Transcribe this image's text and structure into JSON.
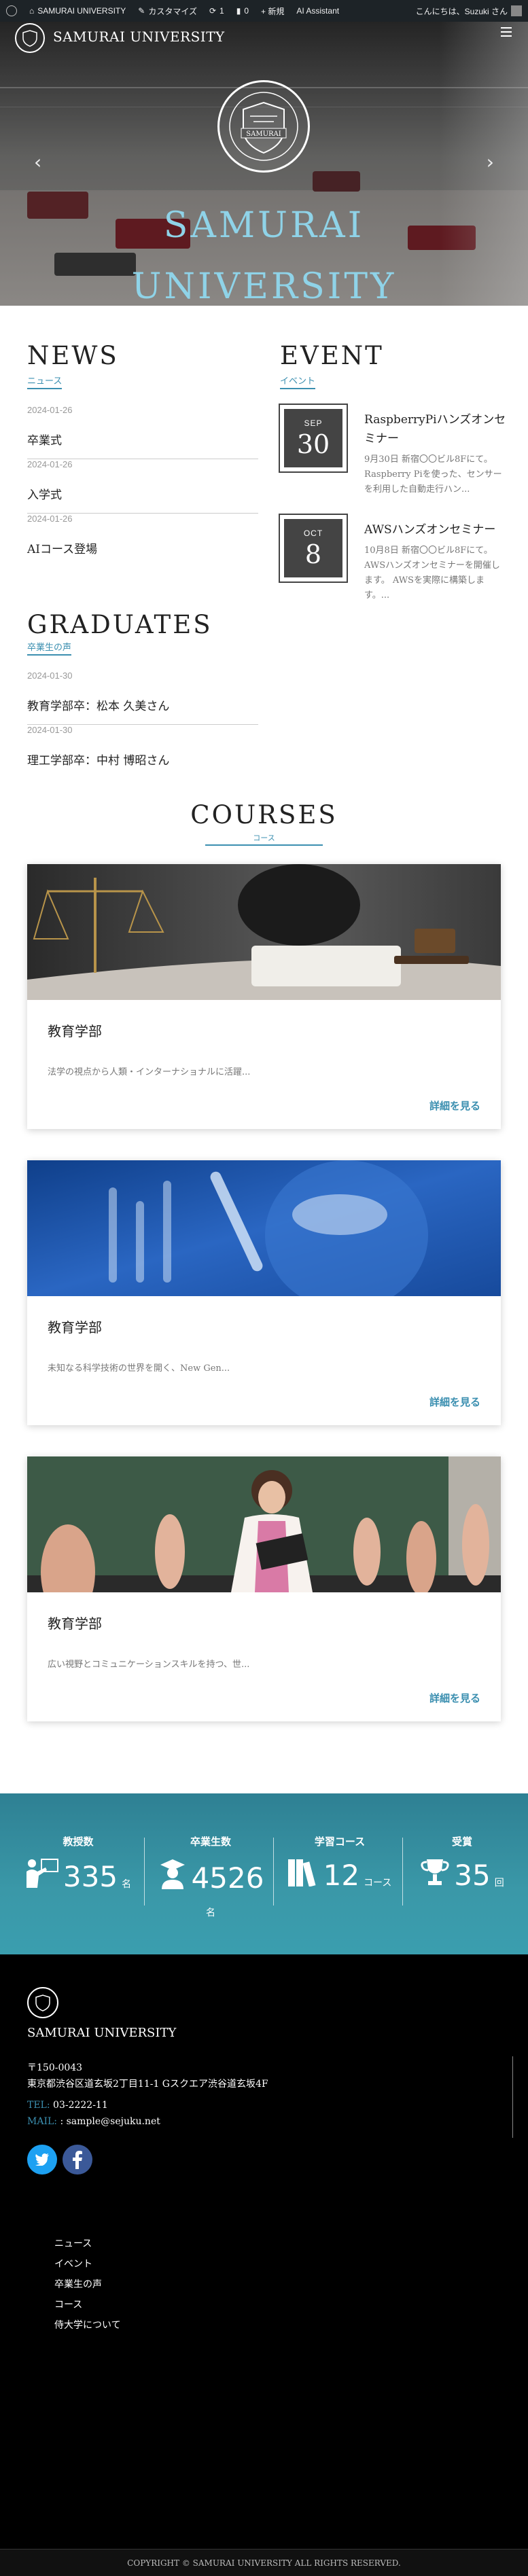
{
  "admin_bar": {
    "site_name": "SAMURAI UNIVERSITY",
    "customize": "カスタマイズ",
    "updates_count": "1",
    "comments_count": "0",
    "new": "+ 新規",
    "ai_assistant": "AI Assistant",
    "greeting": "こんにちは、Suzuki さん"
  },
  "header": {
    "site_name": "SAMURAI UNIVERSITY",
    "crest_text": "SAMURAI",
    "hero_title_line1": "SAMURAI",
    "hero_title_line2": "UNIVERSITY"
  },
  "news": {
    "heading": "NEWS",
    "subheading": "ニュース",
    "items": [
      {
        "date": "2024-01-26",
        "title": "卒業式"
      },
      {
        "date": "2024-01-26",
        "title": "入学式"
      },
      {
        "date": "2024-01-26",
        "title": "AIコース登場"
      }
    ]
  },
  "event": {
    "heading": "EVENT",
    "subheading": "イベント",
    "items": [
      {
        "month": "SEP",
        "day": "30",
        "title": "RaspberryPiハンズオンセミナー",
        "text": "9月30日 新宿〇〇ビル8Fにて。Raspberry Piを使った、センサーを利用した自動走行ハン..."
      },
      {
        "month": "OCT",
        "day": "8",
        "title": "AWSハンズオンセミナー",
        "text": "10月8日 新宿〇〇ビル8Fにて。AWSハンズオンセミナーを開催します。 AWSを実際に構築します。..."
      }
    ]
  },
  "graduates": {
    "heading": "GRADUATES",
    "subheading": "卒業生の声",
    "items": [
      {
        "date": "2024-01-30",
        "title": "教育学部卒：松本 久美さん"
      },
      {
        "date": "2024-01-30",
        "title": "理工学部卒：中村 博昭さん"
      }
    ]
  },
  "courses": {
    "heading": "COURSES",
    "subheading": "コース",
    "items": [
      {
        "title": "教育学部",
        "desc": "法学の視点から人類・インターナショナルに活躍...",
        "more": "詳細を見る"
      },
      {
        "title": "教育学部",
        "desc": "未知なる科学技術の世界を開く、New Gen...",
        "more": "詳細を見る"
      },
      {
        "title": "教育学部",
        "desc": "広い視野とコミュニケーションスキルを持つ、世...",
        "more": "詳細を見る"
      }
    ]
  },
  "stats": [
    {
      "label": "教授数",
      "value": "335",
      "unit": "名",
      "icon": "teacher-icon"
    },
    {
      "label": "卒業生数",
      "value": "4526",
      "unit": "名",
      "icon": "graduates-icon"
    },
    {
      "label": "学習コース",
      "value": "12",
      "unit": "コース",
      "icon": "books-icon"
    },
    {
      "label": "受賞",
      "value": "35",
      "unit": "回",
      "icon": "trophy-icon"
    }
  ],
  "footer": {
    "site_name": "SAMURAI UNIVERSITY",
    "postal": "〒150-0043",
    "address": "東京都渋谷区道玄坂2丁目11-1 Gスクエア渋谷道玄坂4F",
    "tel_label": "TEL:",
    "tel": "03-2222-11",
    "mail_label": "MAIL:",
    "mail": ": sample@sejuku.net",
    "menu": [
      "ニュース",
      "イベント",
      "卒業生の声",
      "コース",
      "侍大学について"
    ],
    "copyright": "COPYRIGHT © SAMURAI UNIVERSITY ALL RIGHTS RESERVED."
  },
  "colors": {
    "accent": "#3b8fb0",
    "hero_title": "#8fd3e8",
    "stats_bg": "#3a98a8",
    "footer_bg": "#000000"
  }
}
